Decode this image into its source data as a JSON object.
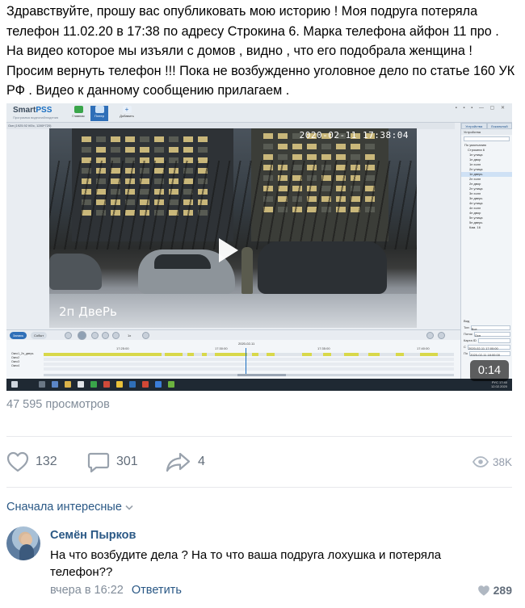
{
  "post": {
    "text": "Здравствуйте, прошу вас опубликовать мою историю ! Моя подруга потеряла телефон 11.02.20 в 17:38 по адресу Строкина 6. Марка телефона айфон 11 про . На видео которое мы изъяли с домов , видно , что его подобрала женщина ! Просим вернуть телефон !!! Пока не возбужденно уголовное дело по статье 160 УК РФ . Видео к данному сообщению прилагаем ."
  },
  "video": {
    "timestamp": "2020-02-11 17:38:04",
    "camera_label": "2п ДвеРь",
    "duration": "0:14",
    "play_icon": "play-icon",
    "app": {
      "logo_main": "Smart",
      "logo_accent": "PSS",
      "logo_sub": "Программа видеонаблюдения",
      "tabs": [
        "Главная",
        "Плеер",
        "Добавить"
      ],
      "subbar": "Окн (1925.92 Кб/с, 1280*720)",
      "side_tabs": [
        "Устройства",
        "Локальный"
      ],
      "side_title": "Устройства",
      "tree": [
        "По умолчанию",
        "Строкина 6",
        "1п улица",
        "1п двор",
        "1п холл",
        "2п улица",
        "1п дверь",
        "2п холл",
        "2п двор",
        "2п улица",
        "3п холл",
        "3п дверь",
        "4п улица",
        "4п холл",
        "4п двор",
        "5п улица",
        "5п дверь",
        "Кам. 16"
      ],
      "selected_tree_index": 6,
      "side_bottom_label": "Вид",
      "side_fields": [
        {
          "label": "Тип",
          "value": "Все"
        },
        {
          "label": "Поток",
          "value": "Осн"
        },
        {
          "label": "Карта ID",
          "value": ""
        },
        {
          "label": "С",
          "value": "2020-02-11 17:00:00"
        },
        {
          "label": "По",
          "value": "2020-02-11 18:00:00"
        }
      ],
      "ctrl_left": [
        "Запись",
        "Событ"
      ],
      "ctrl_speed": "1x",
      "timeline_date": "2020-02-11",
      "timeline_times": [
        "17:25:00",
        "17:30:00",
        "17:35:00",
        "17:40:00"
      ],
      "timeline_channels": [
        "Окно1_2п_дверь",
        "Окно2",
        "Окно3",
        "Окно4"
      ],
      "clock_time": "17:40",
      "clock_date": "12.02.2020",
      "lang": "РУС"
    }
  },
  "stats": {
    "views_text": "47 595 просмотров",
    "likes": "132",
    "comments": "301",
    "shares": "4",
    "views_short": "38K"
  },
  "comments_sort": "Сначала интересные",
  "comment": {
    "author": "Семён Пырков",
    "text": "На что возбудите дела ? На то что ваша подруга лохушка и потеряла телефон??",
    "time": "вчера в 16:22",
    "reply": "Ответить",
    "likes": "289"
  },
  "colors": {
    "link": "#2a5885",
    "muted": "#818c99",
    "icon": "#99a2ad",
    "timeline_segment": "#d8d84a",
    "duration_bg": "rgba(0,0,0,0.62)"
  }
}
